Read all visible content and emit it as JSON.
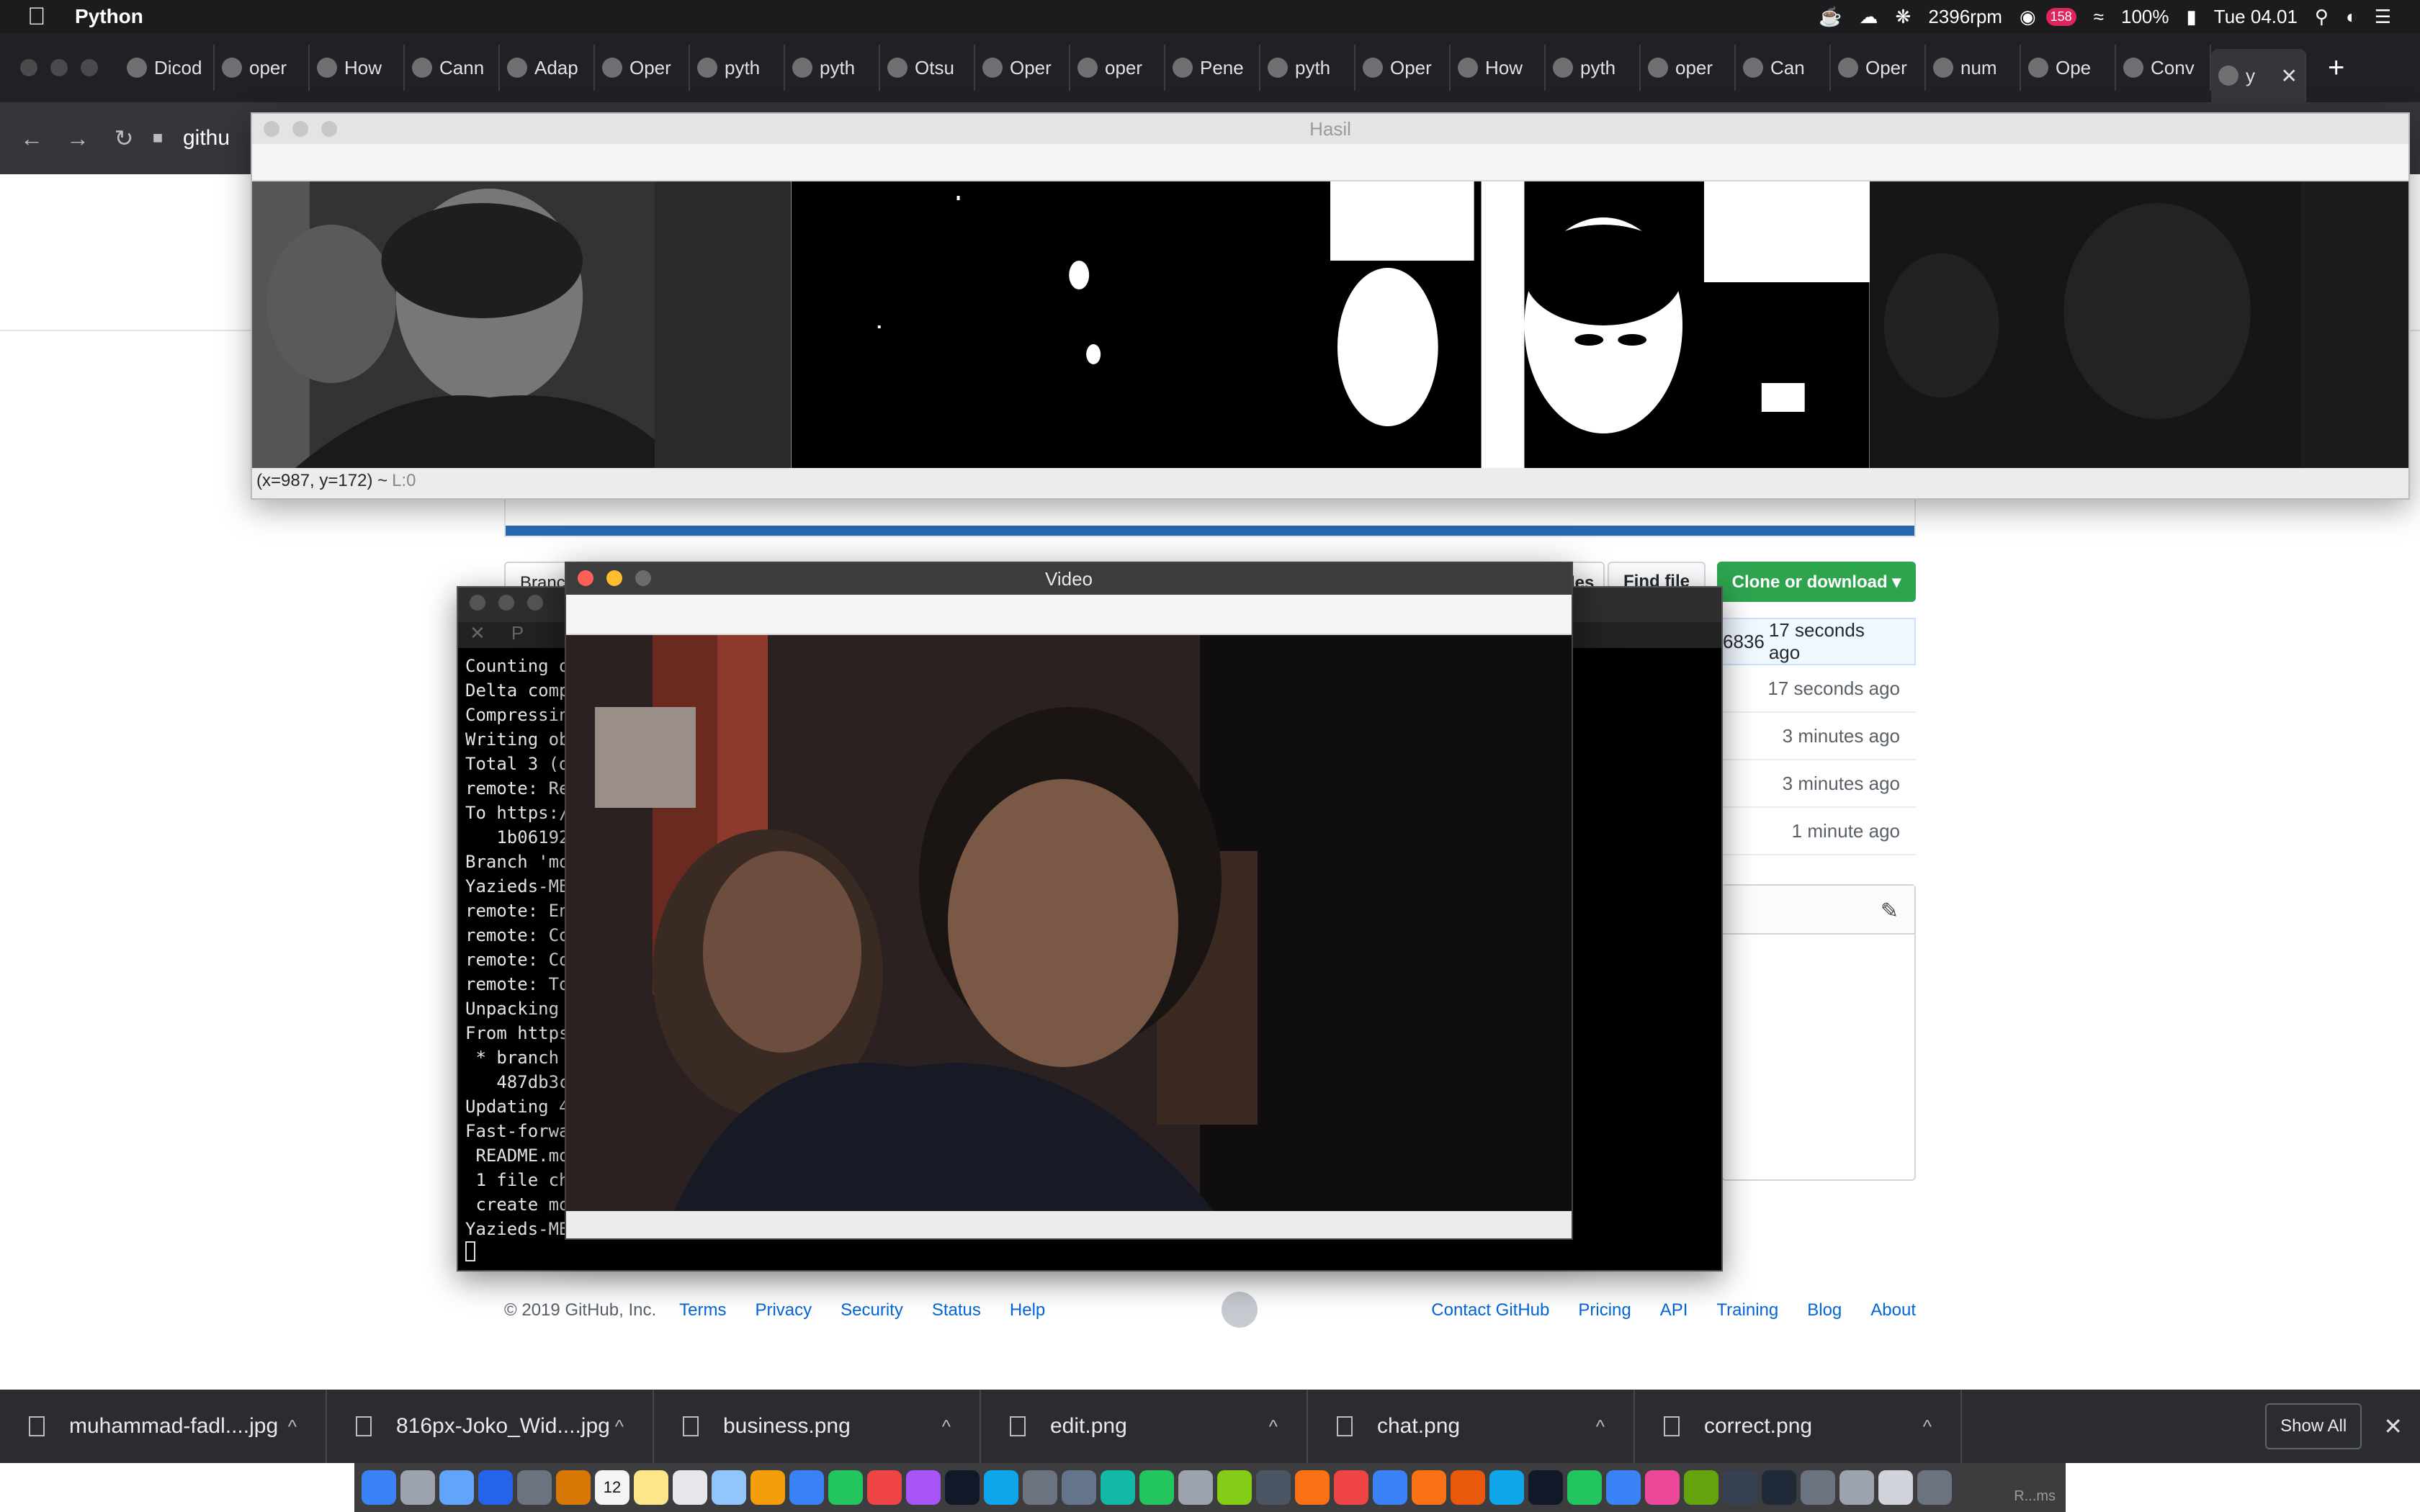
{
  "menubar": {
    "app_name": "Python",
    "rpm": "2396rpm",
    "badge_count": "158",
    "battery": "100%",
    "clock": "Tue 04.01"
  },
  "browser": {
    "tabs": [
      {
        "label": "Dicod"
      },
      {
        "label": "oper"
      },
      {
        "label": "How"
      },
      {
        "label": "Cann"
      },
      {
        "label": "Adap"
      },
      {
        "label": "Oper"
      },
      {
        "label": "pyth"
      },
      {
        "label": "pyth"
      },
      {
        "label": "Otsu"
      },
      {
        "label": "Oper"
      },
      {
        "label": "oper"
      },
      {
        "label": "Pene"
      },
      {
        "label": "pyth"
      },
      {
        "label": "Oper"
      },
      {
        "label": "How"
      },
      {
        "label": "pyth"
      },
      {
        "label": "oper"
      },
      {
        "label": "Can"
      },
      {
        "label": "Oper"
      },
      {
        "label": "num"
      },
      {
        "label": "Ope"
      },
      {
        "label": "Conv"
      },
      {
        "label": "y"
      }
    ],
    "address": "githu"
  },
  "github": {
    "find_file": "Find file",
    "clone": "Clone or download ▾",
    "branch_fragment": "Branc",
    "files_fragment": "les",
    "commit_fragment": "6836",
    "file_times": [
      "17 seconds ago",
      "17 seconds ago",
      "3 minutes ago",
      "3 minutes ago",
      "1 minute ago"
    ],
    "footer_copyright": "© 2019 GitHub, Inc.",
    "footer_left": [
      "Terms",
      "Privacy",
      "Security",
      "Status",
      "Help"
    ],
    "footer_right": [
      "Contact GitHub",
      "Pricing",
      "API",
      "Training",
      "Blog",
      "About"
    ]
  },
  "hasil_window": {
    "title": "Hasil",
    "status_coords": "(x=987, y=172) ~",
    "status_level": "L:0"
  },
  "video_window": {
    "title": "Video"
  },
  "terminal": {
    "tab_fragment": "P",
    "lines": [
      "Counting o",
      "Delta comp",
      "Compressin",
      "Writing ob",
      "Total 3 (d",
      "remote: Re",
      "To https:/",
      "   1b06192",
      "Branch 'mo",
      "Yazieds-MB",
      "remote: En",
      "remote: Co",
      "remote: Co",
      "remote: To",
      "Unpacking",
      "From https",
      " * branch",
      "   487db3c",
      "Updating 4",
      "Fast-forwa",
      " README.mo",
      " 1 file ch",
      " create mo",
      "Yazieds-MB"
    ]
  },
  "downloads": {
    "items": [
      {
        "name": "muhammad-fadl....jpg"
      },
      {
        "name": "816px-Joko_Wid....jpg"
      },
      {
        "name": "business.png"
      },
      {
        "name": "edit.png"
      },
      {
        "name": "chat.png"
      },
      {
        "name": "correct.png"
      }
    ],
    "show_all": "Show All"
  },
  "dock": {
    "calendar_day": "12",
    "label": "R...ms"
  },
  "colors": {
    "github_green": "#2ea44f",
    "github_link": "#0366d6",
    "progress_blue": "#2a6ab2",
    "close_red": "#ff5f57",
    "minimize_yellow": "#febc2e"
  }
}
